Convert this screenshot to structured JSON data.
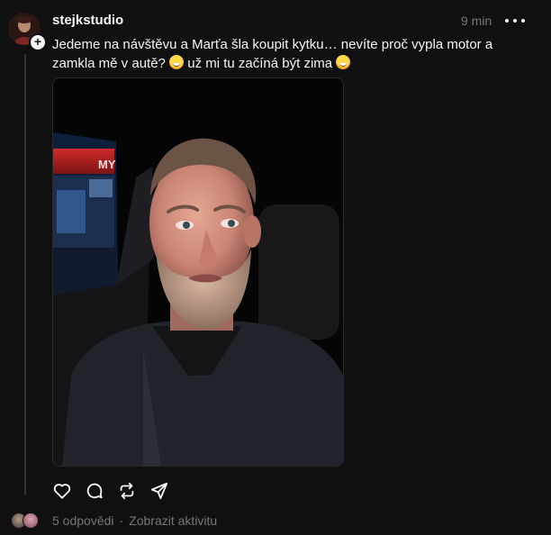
{
  "post": {
    "username": "stejkstudio",
    "timestamp": "9 min",
    "caption_line1": "Jedeme na návštěvu a Marťa šla koupit kytku… nevíte proč vypla motor a",
    "caption_line2_a": "zamkla mě v autě?",
    "caption_line2_b": "už mi tu začíná být zima",
    "follow_symbol": "+",
    "sign_text": "MY"
  },
  "footer": {
    "replies": "5 odpovědi",
    "separator": "·",
    "activity": "Zobrazit aktivitu"
  },
  "colors": {
    "background": "#101010",
    "text_primary": "#f3f5f7",
    "text_secondary": "#777777",
    "thread_line": "#333638"
  },
  "icons": [
    "heart-icon",
    "comment-icon",
    "repost-icon",
    "share-icon",
    "more-icon",
    "plus-icon"
  ]
}
